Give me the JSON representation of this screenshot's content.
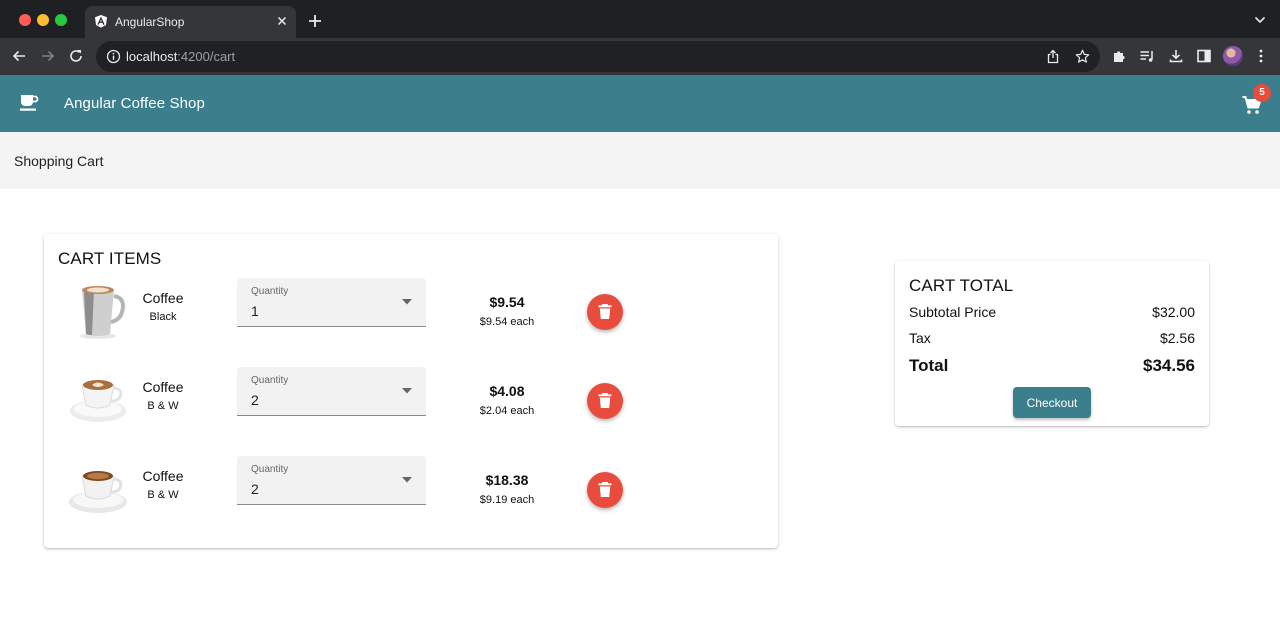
{
  "browser": {
    "tab_title": "AngularShop",
    "url_host": "localhost",
    "url_rest": ":4200/cart"
  },
  "header": {
    "title": "Angular Coffee Shop",
    "cart_count": "5",
    "colors": {
      "primary": "#3b7f8c",
      "badge": "#e74c3c"
    }
  },
  "page": {
    "title": "Shopping Cart"
  },
  "cart_items": {
    "heading": "CART ITEMS",
    "quantity_label": "Quantity",
    "items": [
      {
        "name": "Coffee",
        "variant": "Black",
        "quantity": "1",
        "total": "$9.54",
        "each": "$9.54 each",
        "image": "coffee-mug"
      },
      {
        "name": "Coffee",
        "variant": "B & W",
        "quantity": "2",
        "total": "$4.08",
        "each": "$2.04 each",
        "image": "latte-cup"
      },
      {
        "name": "Coffee",
        "variant": "B & W",
        "quantity": "2",
        "total": "$18.38",
        "each": "$9.19 each",
        "image": "espresso-cup"
      }
    ]
  },
  "cart_total": {
    "heading": "CART TOTAL",
    "subtotal_label": "Subtotal Price",
    "subtotal_value": "$32.00",
    "tax_label": "Tax",
    "tax_value": "$2.56",
    "total_label": "Total",
    "total_value": "$34.56",
    "checkout_label": "Checkout"
  }
}
